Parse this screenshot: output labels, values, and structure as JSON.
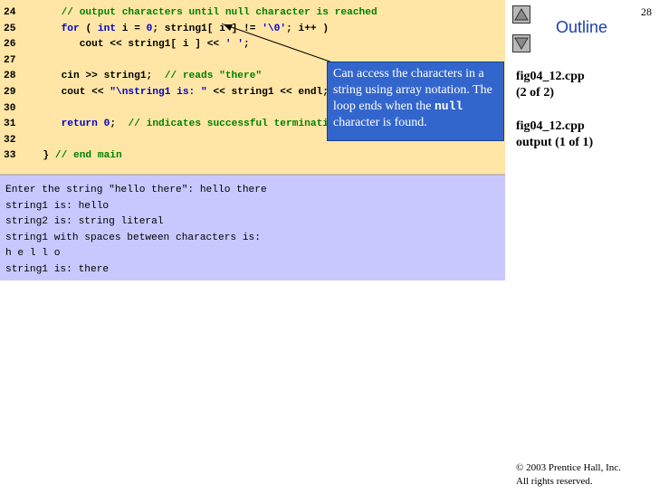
{
  "page_number": "28",
  "outline_label": "Outline",
  "nav": {
    "up_label": "",
    "down_label": ""
  },
  "code_lines": [
    {
      "ln": "24",
      "segments": [
        {
          "t": "     // output characters until null character is reached",
          "c": "cm"
        }
      ]
    },
    {
      "ln": "25",
      "segments": [
        {
          "t": "     ",
          "c": "bk"
        },
        {
          "t": "for",
          "c": "kw"
        },
        {
          "t": " ( ",
          "c": "bk"
        },
        {
          "t": "int",
          "c": "kw"
        },
        {
          "t": " i = ",
          "c": "bk"
        },
        {
          "t": "0",
          "c": "nm"
        },
        {
          "t": "; string1[ i ] != ",
          "c": "bk"
        },
        {
          "t": "'\\0'",
          "c": "st"
        },
        {
          "t": "; i++ )",
          "c": "bk"
        }
      ]
    },
    {
      "ln": "26",
      "segments": [
        {
          "t": "        cout << string1[ i ] << ",
          "c": "bk"
        },
        {
          "t": "' '",
          "c": "st"
        },
        {
          "t": ";",
          "c": "bk"
        }
      ]
    },
    {
      "ln": "27",
      "segments": []
    },
    {
      "ln": "28",
      "segments": [
        {
          "t": "     cin >> string1;  ",
          "c": "bk"
        },
        {
          "t": "// reads \"there\"",
          "c": "cm"
        }
      ]
    },
    {
      "ln": "29",
      "segments": [
        {
          "t": "     cout << ",
          "c": "bk"
        },
        {
          "t": "\"\\nstring1 is: \"",
          "c": "st"
        },
        {
          "t": " << string1 << endl;",
          "c": "bk"
        }
      ]
    },
    {
      "ln": "30",
      "segments": []
    },
    {
      "ln": "31",
      "segments": [
        {
          "t": "     ",
          "c": "bk"
        },
        {
          "t": "return",
          "c": "kw"
        },
        {
          "t": " ",
          "c": "bk"
        },
        {
          "t": "0",
          "c": "nm"
        },
        {
          "t": ";  ",
          "c": "bk"
        },
        {
          "t": "// indicates successful termination",
          "c": "cm"
        }
      ]
    },
    {
      "ln": "32",
      "segments": []
    },
    {
      "ln": "33",
      "segments": [
        {
          "t": "  } ",
          "c": "bk"
        },
        {
          "t": "// end main",
          "c": "cm"
        }
      ]
    }
  ],
  "output_lines": [
    "Enter the string \"hello there\": hello there",
    "string1 is: hello",
    "string2 is: string literal",
    "string1 with spaces between characters is:",
    "h e l l o",
    "string1 is: there"
  ],
  "callout": {
    "text_before": "Can access the characters in a string using array notation. The loop ends when the ",
    "code_word": "null",
    "text_after": " character is found."
  },
  "sidebar": {
    "file1": "fig04_12.cpp",
    "file1_sub": "(2 of 2)",
    "file2": "fig04_12.cpp",
    "file2_sub": "output (1 of 1)"
  },
  "copyright": {
    "line1": "© 2003 Prentice Hall, Inc.",
    "line2": "All rights reserved."
  }
}
